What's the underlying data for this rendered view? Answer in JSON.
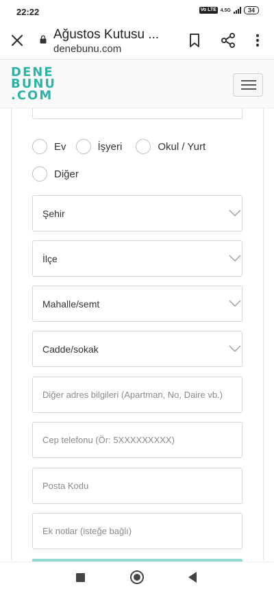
{
  "status_bar": {
    "time": "22:22",
    "volte": "Vo LTE",
    "network": "4.5G",
    "battery": "34"
  },
  "browser": {
    "title": "Ağustos Kutusu ...",
    "url": "denebunu.com"
  },
  "site": {
    "logo_line1": "DENE",
    "logo_line2": "BUNU",
    "logo_line3": ".COM",
    "brand_color": "#2cb3a7"
  },
  "address_type": {
    "options": [
      "Ev",
      "İşyeri",
      "Okul / Yurt",
      "Diğer"
    ]
  },
  "form": {
    "city": "Şehir",
    "district": "İlçe",
    "neighborhood": "Mahalle/semt",
    "street": "Cadde/sokak",
    "address_details_placeholder": "Diğer adres bilgileri (Apartman, No, Daire vb.)",
    "phone_placeholder": "Cep telefonu (Ör: 5XXXXXXXXX)",
    "postal_code_placeholder": "Posta Kodu",
    "notes_placeholder": "Ek notlar (isteğe bağlı)"
  }
}
